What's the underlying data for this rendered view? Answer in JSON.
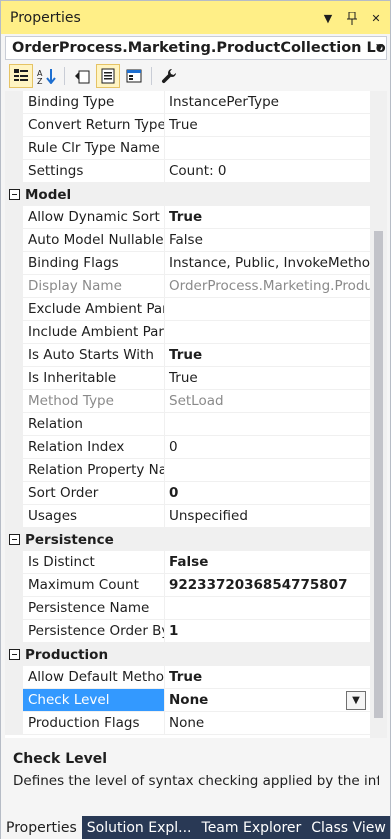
{
  "window": {
    "title": "Properties"
  },
  "object_selector": {
    "value": "OrderProcess.Marketing.ProductCollection LoadByA"
  },
  "groups": [
    {
      "name": "",
      "rows": [
        {
          "name": "Binding Type",
          "value": "InstancePerType",
          "style": "normal"
        },
        {
          "name": "Convert Return Type",
          "value": "True",
          "style": "normal"
        },
        {
          "name": "Rule Clr Type Name",
          "value": "",
          "style": "normal"
        },
        {
          "name": "Settings",
          "value": "Count: 0",
          "style": "normal"
        }
      ]
    },
    {
      "name": "Model",
      "rows": [
        {
          "name": "Allow Dynamic Sort",
          "value": "True",
          "style": "bold"
        },
        {
          "name": "Auto Model Nullable",
          "value": "False",
          "style": "normal"
        },
        {
          "name": "Binding Flags",
          "value": "Instance, Public, InvokeMethod",
          "style": "normal"
        },
        {
          "name": "Display Name",
          "value": "OrderProcess.Marketing.ProductCollection",
          "style": "readonly"
        },
        {
          "name": "Exclude Ambient Par",
          "value": "",
          "style": "normal"
        },
        {
          "name": "Include Ambient Par",
          "value": "",
          "style": "normal"
        },
        {
          "name": "Is Auto Starts With",
          "value": "True",
          "style": "bold"
        },
        {
          "name": "Is Inheritable",
          "value": "True",
          "style": "normal"
        },
        {
          "name": "Method Type",
          "value": "SetLoad",
          "style": "readonly"
        },
        {
          "name": "Relation",
          "value": "",
          "style": "normal"
        },
        {
          "name": "Relation Index",
          "value": "0",
          "style": "normal"
        },
        {
          "name": "Relation Property Na",
          "value": "",
          "style": "normal"
        },
        {
          "name": "Sort Order",
          "value": "0",
          "style": "bold"
        },
        {
          "name": "Usages",
          "value": "Unspecified",
          "style": "normal"
        }
      ]
    },
    {
      "name": "Persistence",
      "rows": [
        {
          "name": "Is Distinct",
          "value": "False",
          "style": "bold"
        },
        {
          "name": "Maximum Count",
          "value": "9223372036854775807",
          "style": "bold"
        },
        {
          "name": "Persistence Name",
          "value": "",
          "style": "normal"
        },
        {
          "name": "Persistence Order By",
          "value": "1",
          "style": "bold"
        }
      ]
    },
    {
      "name": "Production",
      "rows": [
        {
          "name": "Allow Default Metho",
          "value": "True",
          "style": "bold"
        },
        {
          "name": "Check Level",
          "value": "None",
          "style": "selected"
        },
        {
          "name": "Production Flags",
          "value": "None",
          "style": "normal"
        }
      ]
    }
  ],
  "description": {
    "title": "Check Level",
    "text": "Defines the level of syntax checking applied by the inf..."
  },
  "tabs": [
    {
      "label": "Properties",
      "active": true
    },
    {
      "label": "Solution Expl...",
      "active": false
    },
    {
      "label": "Team Explorer",
      "active": false
    },
    {
      "label": "Class View",
      "active": false
    }
  ]
}
